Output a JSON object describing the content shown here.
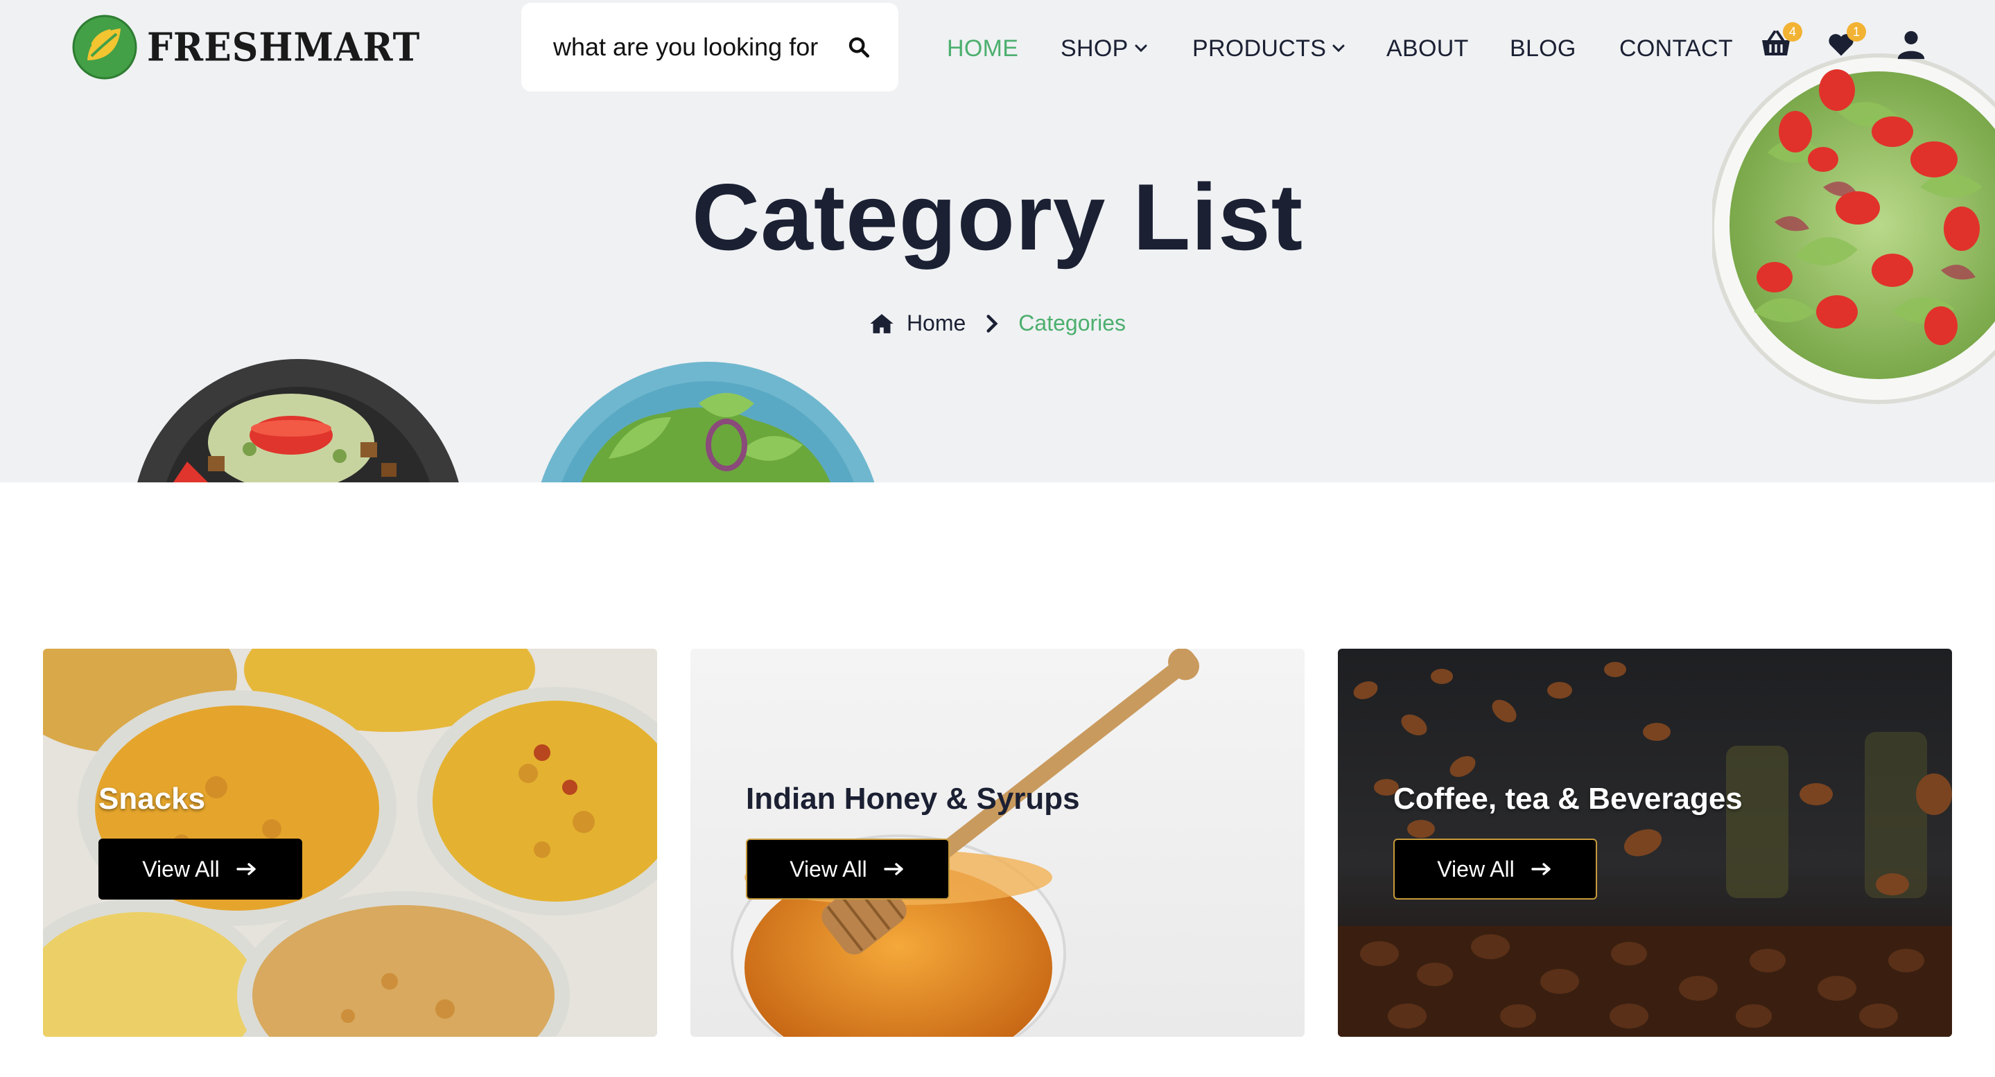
{
  "brand": {
    "name": "FRESHMART"
  },
  "search": {
    "placeholder": "what are you looking for"
  },
  "nav": {
    "items": [
      {
        "label": "HOME",
        "active": true
      },
      {
        "label": "SHOP",
        "dropdown": true
      },
      {
        "label": "PRODUCTS",
        "dropdown": true
      },
      {
        "label": "ABOUT"
      },
      {
        "label": "BLOG"
      },
      {
        "label": "CONTACT"
      }
    ]
  },
  "header_icons": {
    "cart": {
      "icon": "shopping-basket-icon",
      "count": "4"
    },
    "wishlist": {
      "icon": "heart-icon",
      "count": "1"
    },
    "account": {
      "icon": "user-icon"
    }
  },
  "hero": {
    "title": "Category List",
    "breadcrumb": {
      "home": "Home",
      "current": "Categories"
    }
  },
  "categories": [
    {
      "title": "Snacks",
      "button": "View All"
    },
    {
      "title": "Indian Honey & Syrups",
      "button": "View All"
    },
    {
      "title": "Coffee, tea & Beverages",
      "button": "View All"
    }
  ],
  "colors": {
    "accent": "#4caf6e",
    "dark": "#1b2033",
    "badge": "#f2b233",
    "hero_bg": "#eff1f3"
  }
}
